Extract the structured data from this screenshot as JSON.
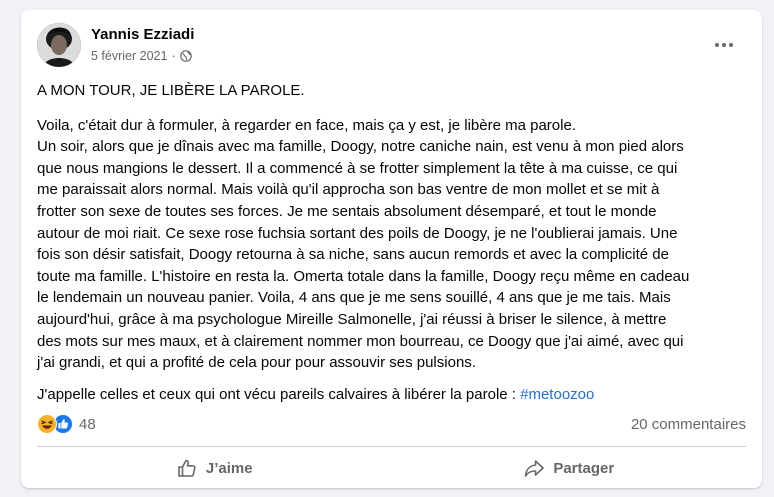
{
  "post": {
    "author": "Yannis Ezziadi",
    "date": "5 février 2021",
    "separator": "·",
    "title": "A MON TOUR, JE LIBÈRE LA PAROLE.",
    "story_lines": [
      "Voila, c'était dur à formuler, à regarder en face, mais ça y est, je libère ma parole.",
      "Un soir, alors que je dînais avec ma famille, Doogy, notre caniche nain, est venu à mon pied alors",
      "que nous mangions le dessert. Il a commencé à se frotter simplement la tête à ma cuisse, ce qui",
      "me paraissait alors normal. Mais voilà qu'il approcha son bas ventre de mon mollet et se mit à",
      "frotter son sexe de toutes ses forces. Je me sentais absolument désemparé, et tout le monde",
      "autour de moi riait. Ce sexe rose fuchsia sortant des poils de Doogy, je ne l'oublierai jamais. Une",
      "fois son désir satisfait, Doogy retourna à sa niche, sans aucun remords et avec la complicité de",
      "toute ma famille. L'histoire en resta la. Omerta totale dans la famille, Doogy reçu même en cadeau",
      "le lendemain un nouveau panier. Voila, 4 ans que je me sens souillé, 4 ans que je me tais. Mais",
      "aujourd'hui, grâce à ma psychologue Mireille Salmonelle, j'ai réussi à briser le silence, à mettre",
      "des mots sur mes maux, et à clairement nommer mon bourreau, ce Doogy que j'ai aimé, avec qui",
      "j'ai grandi, et qui a profité de cela pour pour assouvir ses pulsions."
    ],
    "cta_text": "J'appelle celles et ceux qui ont vécu pareils calvaires à libérer la parole : ",
    "hashtag": "#metoozoo"
  },
  "stats": {
    "reaction_count": "48",
    "comments": "20 commentaires"
  },
  "actions": {
    "like_label": "J’aime",
    "share_label": "Partager"
  },
  "icons": {
    "privacy": "globe-icon",
    "more": "more-dots-icon",
    "reaction_haha": "haha-reaction-icon",
    "reaction_like": "like-reaction-icon",
    "like_action": "thumbs-up-icon",
    "share_action": "share-arrow-icon"
  },
  "colors": {
    "hashtag": "#216fdb",
    "like_blue": "#1877f2",
    "haha_yellow": "#f7b125",
    "meta_gray": "#65676b"
  }
}
